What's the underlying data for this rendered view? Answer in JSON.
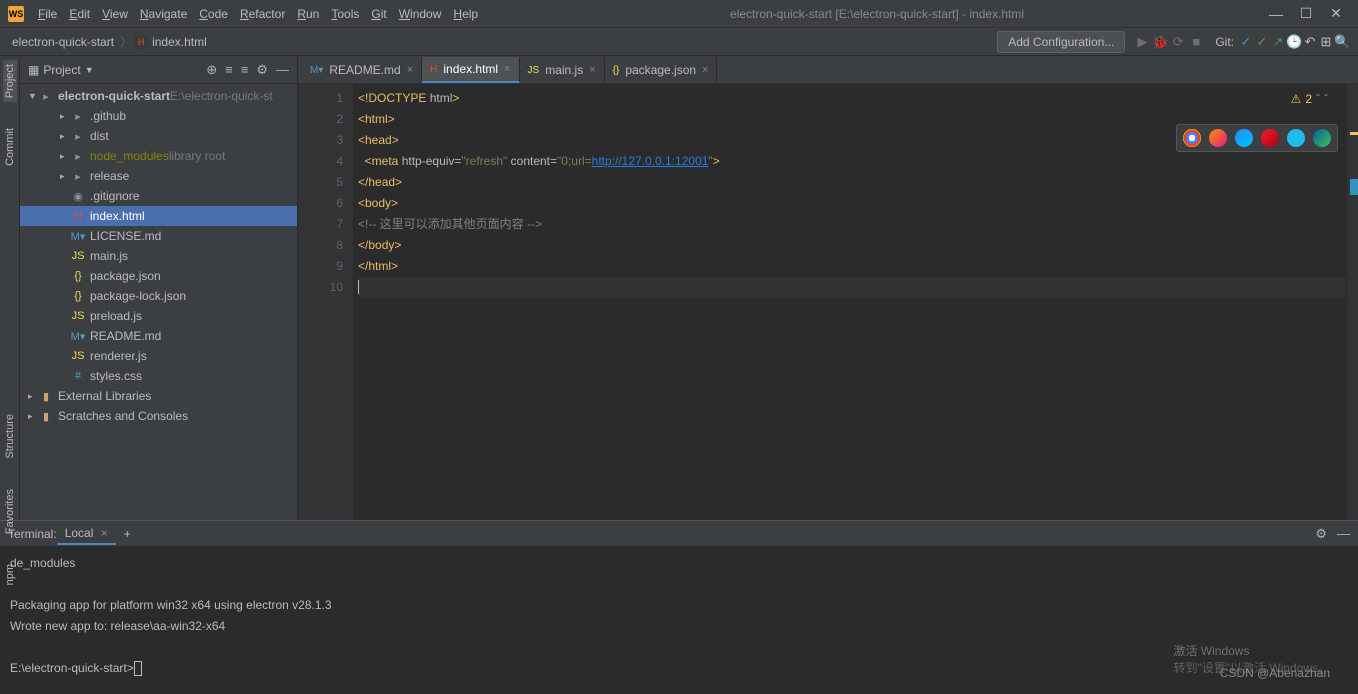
{
  "title": "electron-quick-start [E:\\electron-quick-start] - index.html",
  "menu": [
    "File",
    "Edit",
    "View",
    "Navigate",
    "Code",
    "Refactor",
    "Run",
    "Tools",
    "Git",
    "Window",
    "Help"
  ],
  "breadcrumb": {
    "root": "electron-quick-start",
    "file": "index.html"
  },
  "navbar": {
    "add_config": "Add Configuration...",
    "git_label": "Git:"
  },
  "sidebar": {
    "title": "Project",
    "root": "electron-quick-start",
    "root_path": "E:\\electron-quick-st",
    "items": [
      {
        "name": ".github",
        "type": "folder",
        "indent": 1
      },
      {
        "name": "dist",
        "type": "folder",
        "indent": 1
      },
      {
        "name": "node_modules",
        "type": "folder",
        "indent": 1,
        "suffix": "library root",
        "excl": true
      },
      {
        "name": "release",
        "type": "folder",
        "indent": 1
      },
      {
        "name": ".gitignore",
        "type": "file",
        "icon": "txt",
        "indent": 1
      },
      {
        "name": "index.html",
        "type": "file",
        "icon": "html",
        "indent": 1,
        "selected": true
      },
      {
        "name": "LICENSE.md",
        "type": "file",
        "icon": "md",
        "indent": 1
      },
      {
        "name": "main.js",
        "type": "file",
        "icon": "js",
        "indent": 1
      },
      {
        "name": "package.json",
        "type": "file",
        "icon": "json",
        "indent": 1
      },
      {
        "name": "package-lock.json",
        "type": "file",
        "icon": "json",
        "indent": 1
      },
      {
        "name": "preload.js",
        "type": "file",
        "icon": "js",
        "indent": 1
      },
      {
        "name": "README.md",
        "type": "file",
        "icon": "md",
        "indent": 1
      },
      {
        "name": "renderer.js",
        "type": "file",
        "icon": "js",
        "indent": 1
      },
      {
        "name": "styles.css",
        "type": "file",
        "icon": "css",
        "indent": 1
      }
    ],
    "libs": "External Libraries",
    "scratches": "Scratches and Consoles"
  },
  "tabs": [
    {
      "label": "README.md",
      "icon": "md",
      "close": true
    },
    {
      "label": "index.html",
      "icon": "html",
      "active": true,
      "close": true
    },
    {
      "label": "main.js",
      "icon": "js",
      "close": true
    },
    {
      "label": "package.json",
      "icon": "json",
      "close": true
    }
  ],
  "editor": {
    "warnings": "2",
    "lines": [
      {
        "n": 1,
        "html": "<span class='tag'>&lt;!DOCTYPE</span> <span class='attr-n'>html</span><span class='tag'>&gt;</span>"
      },
      {
        "n": 2,
        "html": "<span class='tag'>&lt;html&gt;</span>"
      },
      {
        "n": 3,
        "html": "<span class='tag'>&lt;head&gt;</span>"
      },
      {
        "n": 4,
        "html": "  <span class='tag'>&lt;meta</span> <span class='attr-n'>http-equiv</span>=<span class='attr-v'>\"refresh\"</span> <span class='attr-n'>content</span>=<span class='attr-v'>\"0;url=</span><span class='link'>http://127.0.0.1:12001</span><span class='attr-v'>\"</span><span class='tag'>&gt;</span>"
      },
      {
        "n": 5,
        "html": "<span class='tag'>&lt;/head&gt;</span>"
      },
      {
        "n": 6,
        "html": "<span class='tag'>&lt;body&gt;</span>"
      },
      {
        "n": 7,
        "html": "<span class='comment'>&lt;!-- 这里可以添加其他页面内容 --&gt;</span>"
      },
      {
        "n": 8,
        "html": "<span class='tag'>&lt;/body&gt;</span>"
      },
      {
        "n": 9,
        "html": "<span class='tag'>&lt;/html&gt;</span>"
      },
      {
        "n": 10,
        "html": "",
        "caret": true
      }
    ]
  },
  "terminal": {
    "title": "Terminal:",
    "tab": "Local",
    "lines": [
      "de_modules",
      "",
      "Packaging app for platform win32 x64 using electron v28.1.3",
      "Wrote new app to: release\\aa-win32-x64",
      "",
      "E:\\electron-quick-start>"
    ]
  },
  "left_tabs": [
    "Project",
    "Commit",
    "Structure",
    "Favorites",
    "npm"
  ],
  "watermark": {
    "title": "激活 Windows",
    "sub": "转到\"设置\"以激活 Windows。"
  },
  "csdn": "CSDN @Abenazhan"
}
